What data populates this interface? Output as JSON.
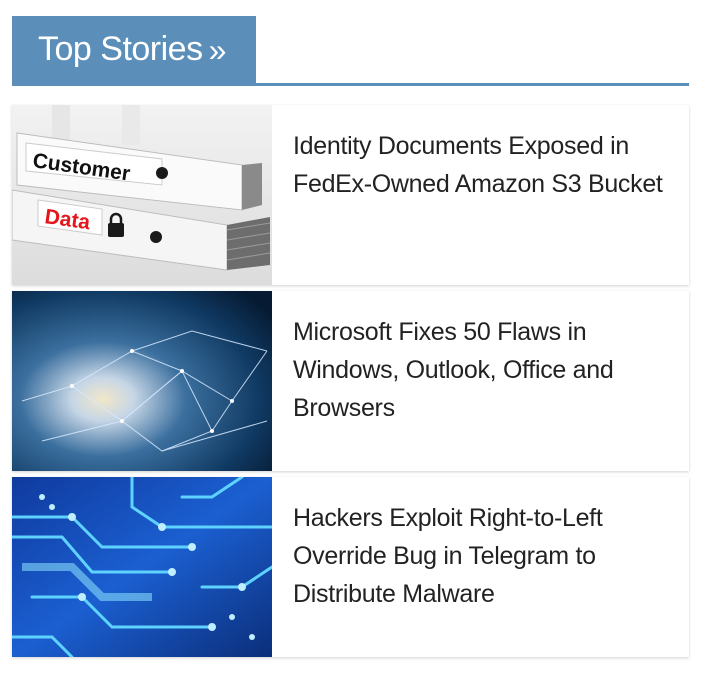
{
  "header": {
    "title": "Top Stories",
    "chevron": "»",
    "accent_color": "#5b8fb9"
  },
  "stories": [
    {
      "title": "Identity Documents Exposed in FedEx-Owned Amazon S3 Bucket",
      "image": "binder-customer-data",
      "image_labels": [
        "Customer",
        "Data"
      ]
    },
    {
      "title": "Microsoft Fixes 50 Flaws in Windows, Outlook, Office and Browsers",
      "image": "blue-network-abstract"
    },
    {
      "title": "Hackers Exploit Right-to-Left Override Bug in Telegram to Distribute Malware",
      "image": "circuit-board-blue"
    }
  ]
}
